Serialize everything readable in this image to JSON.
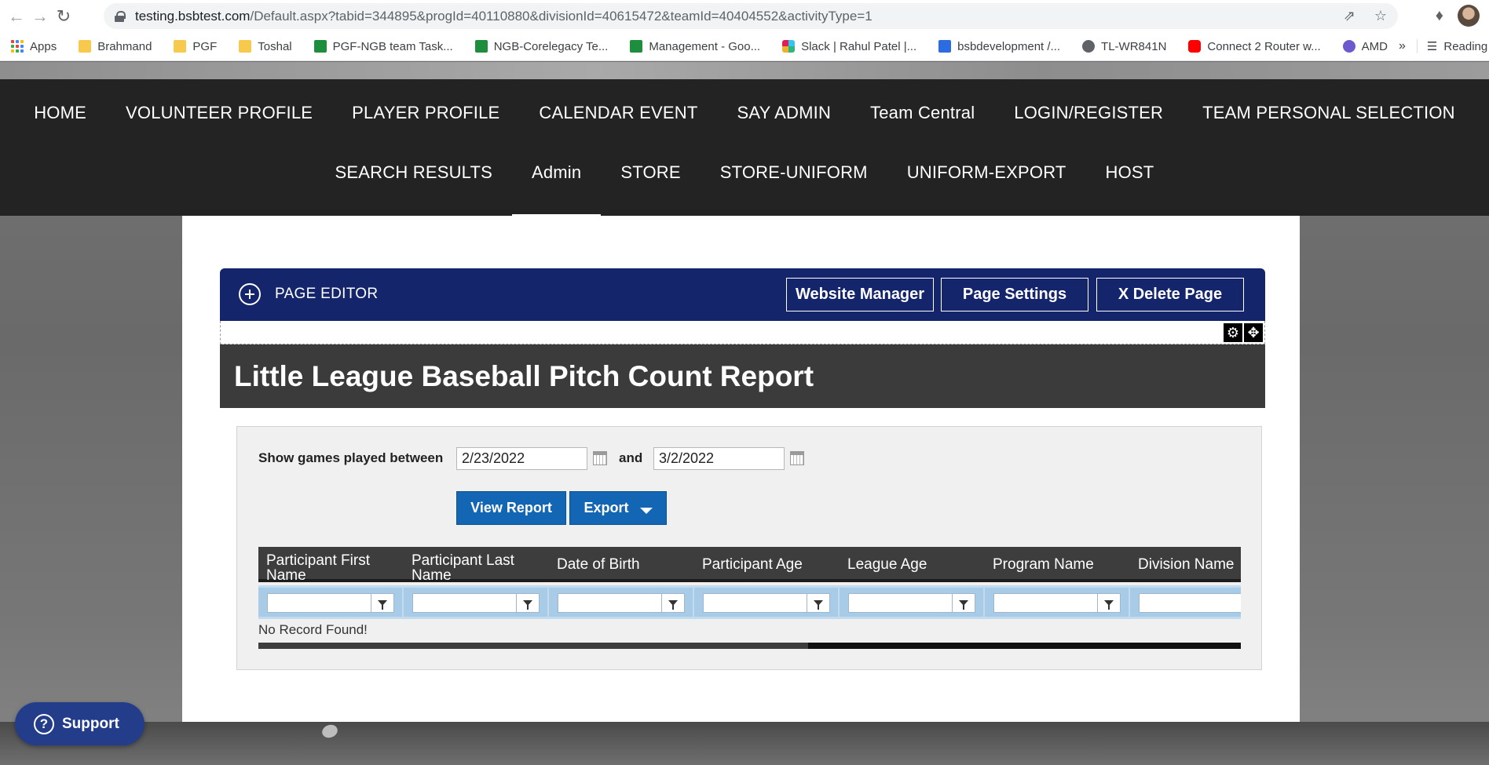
{
  "browser": {
    "url_host": "testing.bsbtest.com",
    "url_path": "/Default.aspx?tabid=344895&progId=40110880&divisionId=40615472&teamId=40404552&activityType=1",
    "bookmarks": [
      {
        "label": "Apps",
        "icon": "apps-grid-icon"
      },
      {
        "label": "Brahmand",
        "icon": "folder-icon"
      },
      {
        "label": "PGF",
        "icon": "folder-icon"
      },
      {
        "label": "Toshal",
        "icon": "folder-icon"
      },
      {
        "label": "PGF-NGB team Task...",
        "icon": "sheets-icon"
      },
      {
        "label": "NGB-Corelegacy Te...",
        "icon": "sheets-icon"
      },
      {
        "label": "Management - Goo...",
        "icon": "sheets-icon"
      },
      {
        "label": "Slack | Rahul Patel |...",
        "icon": "slack-icon"
      },
      {
        "label": "bsbdevelopment /...",
        "icon": "shield-icon"
      },
      {
        "label": "TL-WR841N",
        "icon": "globe-icon"
      },
      {
        "label": "Connect 2 Router w...",
        "icon": "youtube-icon"
      },
      {
        "label": "AMD",
        "icon": "amd-icon"
      }
    ],
    "more_label": "»",
    "reading_list": "Reading list"
  },
  "nav": {
    "row1": [
      "HOME",
      "VOLUNTEER PROFILE",
      "PLAYER PROFILE",
      "CALENDAR EVENT",
      "SAY ADMIN",
      "Team Central",
      "LOGIN/REGISTER",
      "TEAM PERSONAL SELECTION"
    ],
    "row2": [
      "SEARCH RESULTS",
      "Admin",
      "STORE",
      "STORE-UNIFORM",
      "UNIFORM-EXPORT",
      "HOST"
    ],
    "active": "Admin"
  },
  "page_editor": {
    "title": "PAGE EDITOR",
    "website_manager": "Website Manager",
    "page_settings": "Page Settings",
    "delete_page": "X Delete Page"
  },
  "report": {
    "title": "Little League Baseball Pitch Count Report",
    "filter_label": "Show games played between",
    "start_date": "2/23/2022",
    "and_label": "and",
    "end_date": "3/2/2022",
    "view_report": "View Report",
    "export": "Export",
    "columns": [
      "Participant First Name",
      "Participant Last Name",
      "Date of Birth",
      "Participant Age",
      "League Age",
      "Program Name",
      "Division Name"
    ],
    "empty_text": "No Record Found!"
  },
  "support": {
    "label": "Support"
  },
  "colors": {
    "nav_bg": "#232323",
    "editor_bar": "#14256b",
    "report_header": "#3b3b3b",
    "button_blue": "#1366b3",
    "support_bg": "#233d8b"
  }
}
